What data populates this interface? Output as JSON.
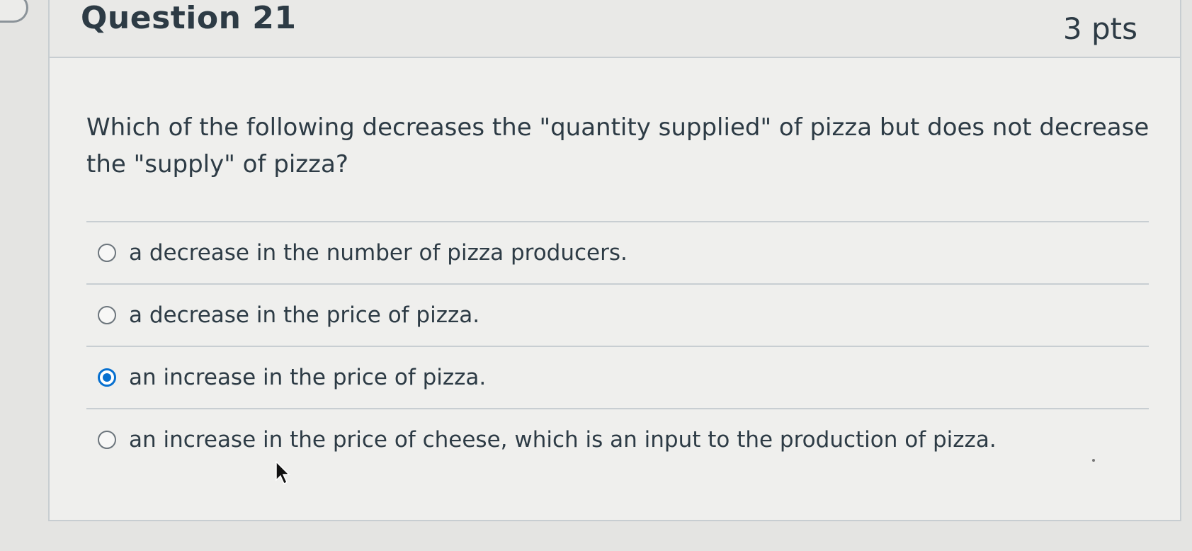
{
  "question": {
    "title": "Question 21",
    "points": "3 pts",
    "text": "Which of the following decreases the \"quantity supplied\" of pizza but does not decrease the \"supply\" of pizza?"
  },
  "answers": [
    {
      "label": "a decrease in the number of pizza producers.",
      "selected": false
    },
    {
      "label": "a decrease in the price of pizza.",
      "selected": false
    },
    {
      "label": "an increase in the price of pizza.",
      "selected": true
    },
    {
      "label": "an increase in the price of cheese, which is an input to the production of pizza.",
      "selected": false
    }
  ],
  "colors": {
    "text": "#2d3b45",
    "selected_radio": "#0770d0",
    "border": "#c7cdd1"
  },
  "icons": {
    "cursor": "mouse-pointer-icon"
  }
}
